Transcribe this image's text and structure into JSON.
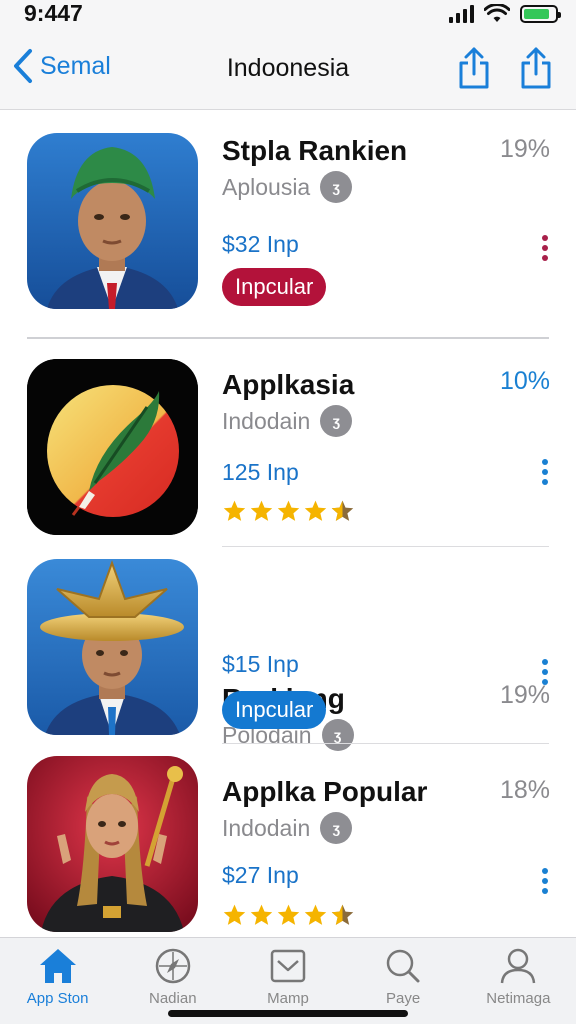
{
  "status": {
    "time": "9:447"
  },
  "nav": {
    "back_label": "Semal",
    "title": "Indoonesia",
    "actions": [
      {
        "icon": "share-icon"
      },
      {
        "icon": "share-icon"
      }
    ]
  },
  "apps": [
    {
      "name": "Stpla Rankien",
      "developer": "Aplousia",
      "badge": "ʒ",
      "price": "$32 Inp",
      "percent": "19%",
      "tag": "Inpcular",
      "tag_color": "#b3123a",
      "more_color": "#a8204a",
      "icon": "avatar-turban-icon"
    },
    {
      "name": "Applkasia",
      "developer": "Indodain",
      "badge": "ʒ",
      "price": "125 Inp",
      "percent": "10%",
      "rating": 4.5,
      "more_color": "#1a80d2",
      "icon": "quill-circle-icon"
    },
    {
      "name": "Rurkinng",
      "developer": "Polodain",
      "badge": "ʒ",
      "price": "$15 Inp",
      "percent": "19%",
      "tag": "Inpcular",
      "tag_color": "#1479d1",
      "more_color": "#1a80d2",
      "icon": "avatar-star-hat-icon"
    },
    {
      "name": "Applka Popular",
      "developer": "Indodain",
      "badge": "ʒ",
      "price": "$27 Inp",
      "percent": "18%",
      "rating": 4.5,
      "more_color": "#1a80d2",
      "icon": "avatar-scepter-icon"
    }
  ],
  "tabs": [
    {
      "label": "App Ston",
      "icon": "home-icon",
      "active": true
    },
    {
      "label": "Nadian",
      "icon": "compass-icon",
      "active": false
    },
    {
      "label": "Mamp",
      "icon": "inbox-icon",
      "active": false
    },
    {
      "label": "Paye",
      "icon": "search-icon",
      "active": false
    },
    {
      "label": "Netimaga",
      "icon": "person-icon",
      "active": false
    }
  ],
  "colors": {
    "accent": "#1a7fd9",
    "star": "#f5b400",
    "tag_red": "#b3123a",
    "tag_blue": "#1479d1"
  }
}
